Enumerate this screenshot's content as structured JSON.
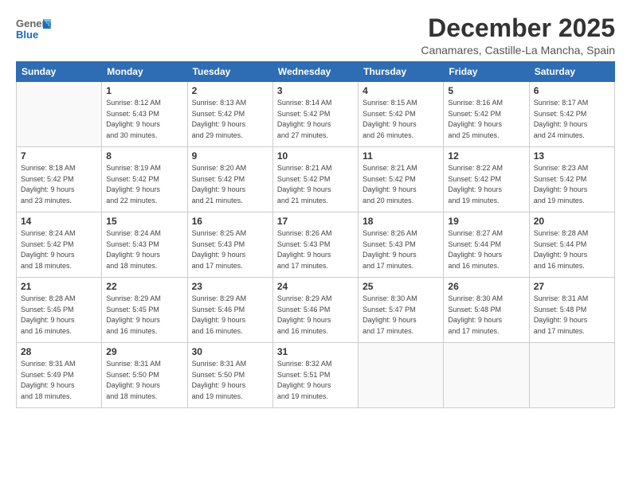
{
  "header": {
    "logo_line1": "General",
    "logo_line2": "Blue",
    "title": "December 2025",
    "subtitle": "Canamares, Castille-La Mancha, Spain"
  },
  "days_of_week": [
    "Sunday",
    "Monday",
    "Tuesday",
    "Wednesday",
    "Thursday",
    "Friday",
    "Saturday"
  ],
  "weeks": [
    [
      {
        "num": "",
        "info": ""
      },
      {
        "num": "1",
        "info": "Sunrise: 8:12 AM\nSunset: 5:43 PM\nDaylight: 9 hours\nand 30 minutes."
      },
      {
        "num": "2",
        "info": "Sunrise: 8:13 AM\nSunset: 5:42 PM\nDaylight: 9 hours\nand 29 minutes."
      },
      {
        "num": "3",
        "info": "Sunrise: 8:14 AM\nSunset: 5:42 PM\nDaylight: 9 hours\nand 27 minutes."
      },
      {
        "num": "4",
        "info": "Sunrise: 8:15 AM\nSunset: 5:42 PM\nDaylight: 9 hours\nand 26 minutes."
      },
      {
        "num": "5",
        "info": "Sunrise: 8:16 AM\nSunset: 5:42 PM\nDaylight: 9 hours\nand 25 minutes."
      },
      {
        "num": "6",
        "info": "Sunrise: 8:17 AM\nSunset: 5:42 PM\nDaylight: 9 hours\nand 24 minutes."
      }
    ],
    [
      {
        "num": "7",
        "info": "Sunrise: 8:18 AM\nSunset: 5:42 PM\nDaylight: 9 hours\nand 23 minutes."
      },
      {
        "num": "8",
        "info": "Sunrise: 8:19 AM\nSunset: 5:42 PM\nDaylight: 9 hours\nand 22 minutes."
      },
      {
        "num": "9",
        "info": "Sunrise: 8:20 AM\nSunset: 5:42 PM\nDaylight: 9 hours\nand 21 minutes."
      },
      {
        "num": "10",
        "info": "Sunrise: 8:21 AM\nSunset: 5:42 PM\nDaylight: 9 hours\nand 21 minutes."
      },
      {
        "num": "11",
        "info": "Sunrise: 8:21 AM\nSunset: 5:42 PM\nDaylight: 9 hours\nand 20 minutes."
      },
      {
        "num": "12",
        "info": "Sunrise: 8:22 AM\nSunset: 5:42 PM\nDaylight: 9 hours\nand 19 minutes."
      },
      {
        "num": "13",
        "info": "Sunrise: 8:23 AM\nSunset: 5:42 PM\nDaylight: 9 hours\nand 19 minutes."
      }
    ],
    [
      {
        "num": "14",
        "info": "Sunrise: 8:24 AM\nSunset: 5:42 PM\nDaylight: 9 hours\nand 18 minutes."
      },
      {
        "num": "15",
        "info": "Sunrise: 8:24 AM\nSunset: 5:43 PM\nDaylight: 9 hours\nand 18 minutes."
      },
      {
        "num": "16",
        "info": "Sunrise: 8:25 AM\nSunset: 5:43 PM\nDaylight: 9 hours\nand 17 minutes."
      },
      {
        "num": "17",
        "info": "Sunrise: 8:26 AM\nSunset: 5:43 PM\nDaylight: 9 hours\nand 17 minutes."
      },
      {
        "num": "18",
        "info": "Sunrise: 8:26 AM\nSunset: 5:43 PM\nDaylight: 9 hours\nand 17 minutes."
      },
      {
        "num": "19",
        "info": "Sunrise: 8:27 AM\nSunset: 5:44 PM\nDaylight: 9 hours\nand 16 minutes."
      },
      {
        "num": "20",
        "info": "Sunrise: 8:28 AM\nSunset: 5:44 PM\nDaylight: 9 hours\nand 16 minutes."
      }
    ],
    [
      {
        "num": "21",
        "info": "Sunrise: 8:28 AM\nSunset: 5:45 PM\nDaylight: 9 hours\nand 16 minutes."
      },
      {
        "num": "22",
        "info": "Sunrise: 8:29 AM\nSunset: 5:45 PM\nDaylight: 9 hours\nand 16 minutes."
      },
      {
        "num": "23",
        "info": "Sunrise: 8:29 AM\nSunset: 5:46 PM\nDaylight: 9 hours\nand 16 minutes."
      },
      {
        "num": "24",
        "info": "Sunrise: 8:29 AM\nSunset: 5:46 PM\nDaylight: 9 hours\nand 16 minutes."
      },
      {
        "num": "25",
        "info": "Sunrise: 8:30 AM\nSunset: 5:47 PM\nDaylight: 9 hours\nand 17 minutes."
      },
      {
        "num": "26",
        "info": "Sunrise: 8:30 AM\nSunset: 5:48 PM\nDaylight: 9 hours\nand 17 minutes."
      },
      {
        "num": "27",
        "info": "Sunrise: 8:31 AM\nSunset: 5:48 PM\nDaylight: 9 hours\nand 17 minutes."
      }
    ],
    [
      {
        "num": "28",
        "info": "Sunrise: 8:31 AM\nSunset: 5:49 PM\nDaylight: 9 hours\nand 18 minutes."
      },
      {
        "num": "29",
        "info": "Sunrise: 8:31 AM\nSunset: 5:50 PM\nDaylight: 9 hours\nand 18 minutes."
      },
      {
        "num": "30",
        "info": "Sunrise: 8:31 AM\nSunset: 5:50 PM\nDaylight: 9 hours\nand 19 minutes."
      },
      {
        "num": "31",
        "info": "Sunrise: 8:32 AM\nSunset: 5:51 PM\nDaylight: 9 hours\nand 19 minutes."
      },
      {
        "num": "",
        "info": ""
      },
      {
        "num": "",
        "info": ""
      },
      {
        "num": "",
        "info": ""
      }
    ]
  ]
}
